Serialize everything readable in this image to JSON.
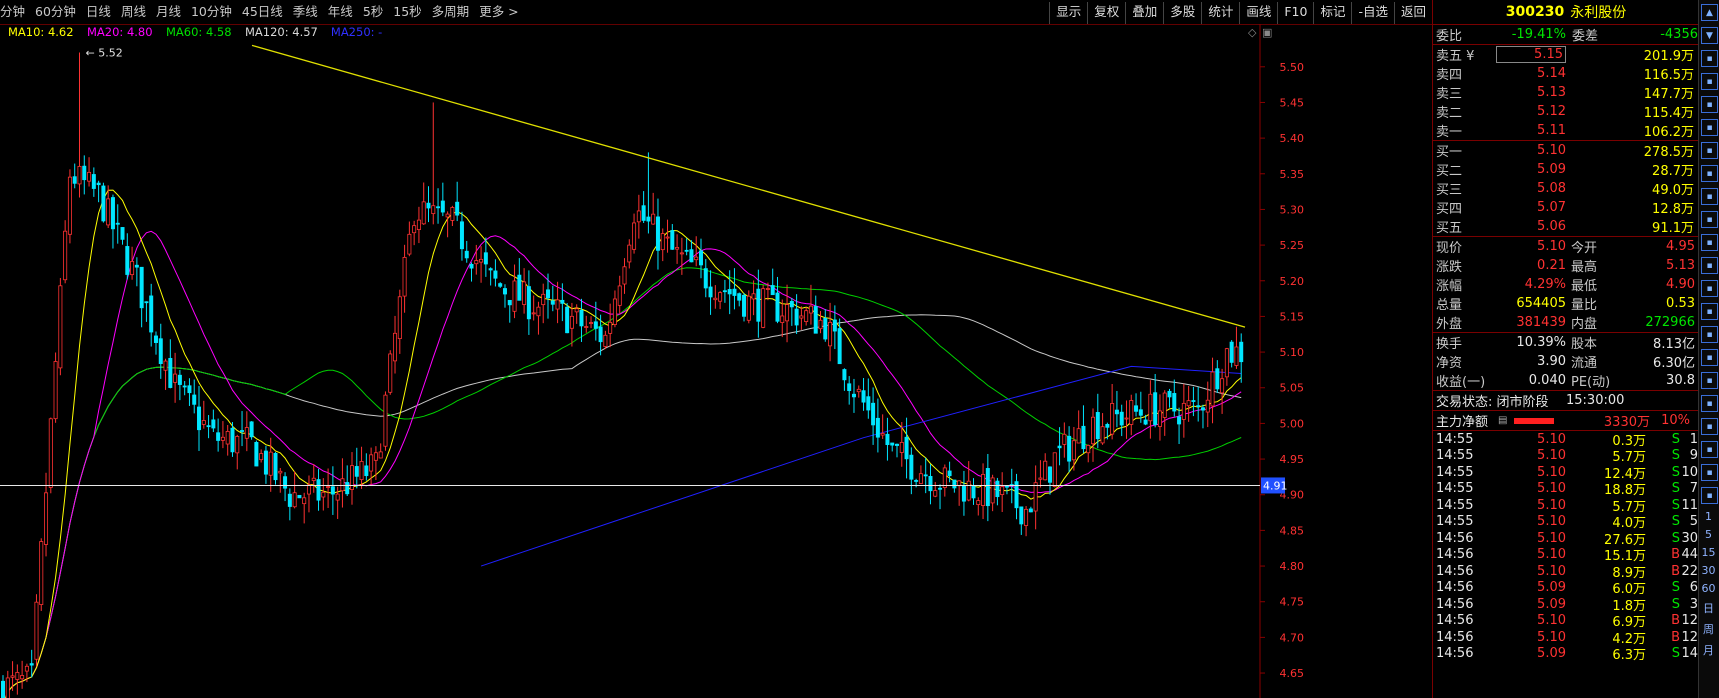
{
  "toolbar": {
    "periods": [
      "分钟",
      "60分钟",
      "日线",
      "周线",
      "月线",
      "10分钟",
      "45日线",
      "季线",
      "年线",
      "5秒",
      "15秒",
      "多周期",
      "更多 >"
    ],
    "tools": [
      "显示",
      "复权",
      "叠加",
      "多股",
      "统计",
      "画线",
      "F10",
      "标记",
      "-自选",
      "返回"
    ]
  },
  "ma_legend": [
    {
      "label": "MA10: 4.62",
      "color": "#ffff00"
    },
    {
      "label": "MA20: 4.80",
      "color": "#ff00ff"
    },
    {
      "label": "MA60: 4.58",
      "color": "#00e000"
    },
    {
      "label": "MA120: 4.57",
      "color": "#d8d8d8"
    },
    {
      "label": "MA250: -",
      "color": "#3030ff"
    }
  ],
  "chart": {
    "y_ticks": [
      "5.50",
      "5.45",
      "5.40",
      "5.35",
      "5.30",
      "5.25",
      "5.20",
      "5.15",
      "5.10",
      "5.05",
      "5.00",
      "4.95",
      "4.90",
      "4.85",
      "4.80",
      "4.75",
      "4.70",
      "4.65"
    ],
    "ylim": [
      4.615,
      5.56
    ],
    "high_label": "5.52",
    "crosshair_label": "4.91",
    "colors": {
      "up": "#ff3232",
      "down": "#00e6ff",
      "ma10": "#ffff00",
      "ma20": "#ff00ff",
      "ma60": "#00d000",
      "ma120": "#c8c8c8",
      "ma250": "#2020ff",
      "trend": "#e0e000"
    }
  },
  "stock": {
    "code": "300230",
    "name": "永利股份"
  },
  "weibi": {
    "label": "委比",
    "value": "-19.41%",
    "label2": "委差",
    "value2": "-4356"
  },
  "asks": [
    {
      "label": "卖五 ¥",
      "price": "5.15",
      "vol": "201.9万"
    },
    {
      "label": "卖四",
      "price": "5.14",
      "vol": "116.5万"
    },
    {
      "label": "卖三",
      "price": "5.13",
      "vol": "147.7万"
    },
    {
      "label": "卖二",
      "price": "5.12",
      "vol": "115.4万"
    },
    {
      "label": "卖一",
      "price": "5.11",
      "vol": "106.2万"
    }
  ],
  "bids": [
    {
      "label": "买一",
      "price": "5.10",
      "vol": "278.5万"
    },
    {
      "label": "买二",
      "price": "5.09",
      "vol": "28.7万"
    },
    {
      "label": "买三",
      "price": "5.08",
      "vol": "49.0万"
    },
    {
      "label": "买四",
      "price": "5.07",
      "vol": "12.8万"
    },
    {
      "label": "买五",
      "price": "5.06",
      "vol": "91.1万"
    }
  ],
  "quote1": [
    {
      "l1": "现价",
      "v1": "5.10",
      "c1": "red",
      "l2": "今开",
      "v2": "4.95",
      "c2": "red"
    },
    {
      "l1": "涨跌",
      "v1": "0.21",
      "c1": "red",
      "l2": "最高",
      "v2": "5.13",
      "c2": "red"
    },
    {
      "l1": "涨幅",
      "v1": "4.29%",
      "c1": "red",
      "l2": "最低",
      "v2": "4.90",
      "c2": "red"
    },
    {
      "l1": "总量",
      "v1": "654405",
      "c1": "yellow",
      "l2": "量比",
      "v2": "0.53",
      "c2": "yellow"
    },
    {
      "l1": "外盘",
      "v1": "381439",
      "c1": "red",
      "l2": "内盘",
      "v2": "272966",
      "c2": "green"
    }
  ],
  "quote2": [
    {
      "l1": "换手",
      "v1": "10.39%",
      "c1": "white",
      "l2": "股本",
      "v2": "8.13亿",
      "c2": "white"
    },
    {
      "l1": "净资",
      "v1": "3.90",
      "c1": "white",
      "l2": "流通",
      "v2": "6.30亿",
      "c2": "white"
    },
    {
      "l1": "收益(一)",
      "v1": "0.040",
      "c1": "white",
      "l2": "PE(动)",
      "v2": "30.8",
      "c2": "white"
    }
  ],
  "status": {
    "label": "交易状态: 闭市阶段",
    "time": "15:30:00"
  },
  "flow": {
    "label": "主力净额",
    "value": "3330万",
    "pct": "10%",
    "bar_fraction": 0.6
  },
  "trades": [
    {
      "t": "14:55",
      "p": "5.10",
      "v": "0.3万",
      "d": "S",
      "n": "1"
    },
    {
      "t": "14:55",
      "p": "5.10",
      "v": "5.7万",
      "d": "S",
      "n": "9"
    },
    {
      "t": "14:55",
      "p": "5.10",
      "v": "12.4万",
      "d": "S",
      "n": "10"
    },
    {
      "t": "14:55",
      "p": "5.10",
      "v": "18.8万",
      "d": "S",
      "n": "7"
    },
    {
      "t": "14:55",
      "p": "5.10",
      "v": "5.7万",
      "d": "S",
      "n": "11"
    },
    {
      "t": "14:55",
      "p": "5.10",
      "v": "4.0万",
      "d": "S",
      "n": "5"
    },
    {
      "t": "14:56",
      "p": "5.10",
      "v": "27.6万",
      "d": "S",
      "n": "30"
    },
    {
      "t": "14:56",
      "p": "5.10",
      "v": "15.1万",
      "d": "B",
      "n": "44"
    },
    {
      "t": "14:56",
      "p": "5.10",
      "v": "8.9万",
      "d": "B",
      "n": "22"
    },
    {
      "t": "14:56",
      "p": "5.09",
      "v": "6.0万",
      "d": "S",
      "n": "6"
    },
    {
      "t": "14:56",
      "p": "5.09",
      "v": "1.8万",
      "d": "S",
      "n": "3"
    },
    {
      "t": "14:56",
      "p": "5.10",
      "v": "6.9万",
      "d": "B",
      "n": "12"
    },
    {
      "t": "14:56",
      "p": "5.10",
      "v": "4.2万",
      "d": "B",
      "n": "12"
    },
    {
      "t": "14:56",
      "p": "5.09",
      "v": "6.3万",
      "d": "S",
      "n": "14"
    }
  ],
  "sidebar": {
    "icons": [
      "arrow-up-icon",
      "arrow-down-icon",
      "chart-icon",
      "chart-icon",
      "chart-icon",
      "chart-icon",
      "chart-icon",
      "chart-icon",
      "chart-icon",
      "chart-icon",
      "chart-icon",
      "chart-icon",
      "chart-icon",
      "chart-icon",
      "chart-icon",
      "chart-icon",
      "chart-icon",
      "chart-icon",
      "chart-icon",
      "chart-icon",
      "chart-icon",
      "chart-icon"
    ],
    "texts": [
      "1",
      "5",
      "15",
      "30",
      "60",
      "日",
      "周",
      "月"
    ]
  }
}
